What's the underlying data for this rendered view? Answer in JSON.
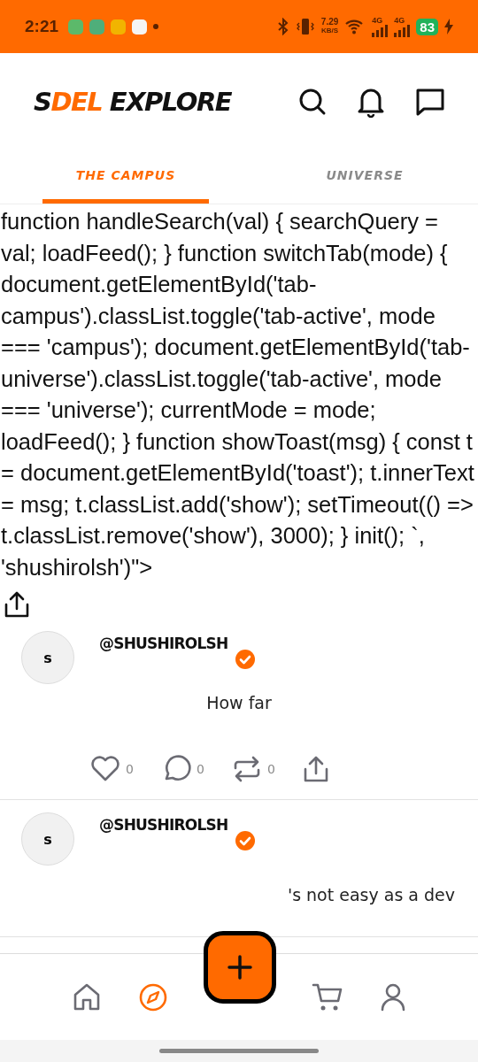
{
  "status_bar": {
    "time": "2:21",
    "speed_value": "7.29",
    "speed_unit": "KB/S",
    "networks": [
      "4G",
      "4G"
    ],
    "battery": "83"
  },
  "header": {
    "logo": [
      {
        "text": "S",
        "accent": false
      },
      {
        "text": "DEL",
        "accent": true
      },
      {
        "text": " EXPLORE",
        "accent": false
      }
    ]
  },
  "tabs": [
    {
      "label": "THE CAMPUS",
      "selected": true
    },
    {
      "label": "UNIVERSE",
      "selected": false
    }
  ],
  "code_text": "function handleSearch(val) { searchQuery = val; loadFeed(); } function switchTab(mode) { document.getElementById('tab-campus').classList.toggle('tab-active', mode === 'campus'); document.getElementById('tab-universe').classList.toggle('tab-active', mode === 'universe'); currentMode = mode; loadFeed(); } function showToast(msg) { const t = document.getElementById('toast'); t.innerText = msg; t.classList.add('show'); setTimeout(() => t.classList.remove('show'), 3000); } init(); `, 'shushirolsh')\">",
  "posts": [
    {
      "avatar": "s",
      "handle": "@SHUSHIROLSH",
      "verified": true,
      "text": "How far",
      "clipped": false,
      "counts": [
        "0",
        "0",
        "0"
      ]
    },
    {
      "avatar": "s",
      "handle": "@SHUSHIROLSH",
      "verified": true,
      "text": "'s not easy as a dev",
      "clipped": true
    }
  ],
  "bottom_nav": [
    {
      "selected": false
    },
    {
      "selected": true
    },
    {
      "selected": false
    },
    {
      "selected": false
    }
  ]
}
